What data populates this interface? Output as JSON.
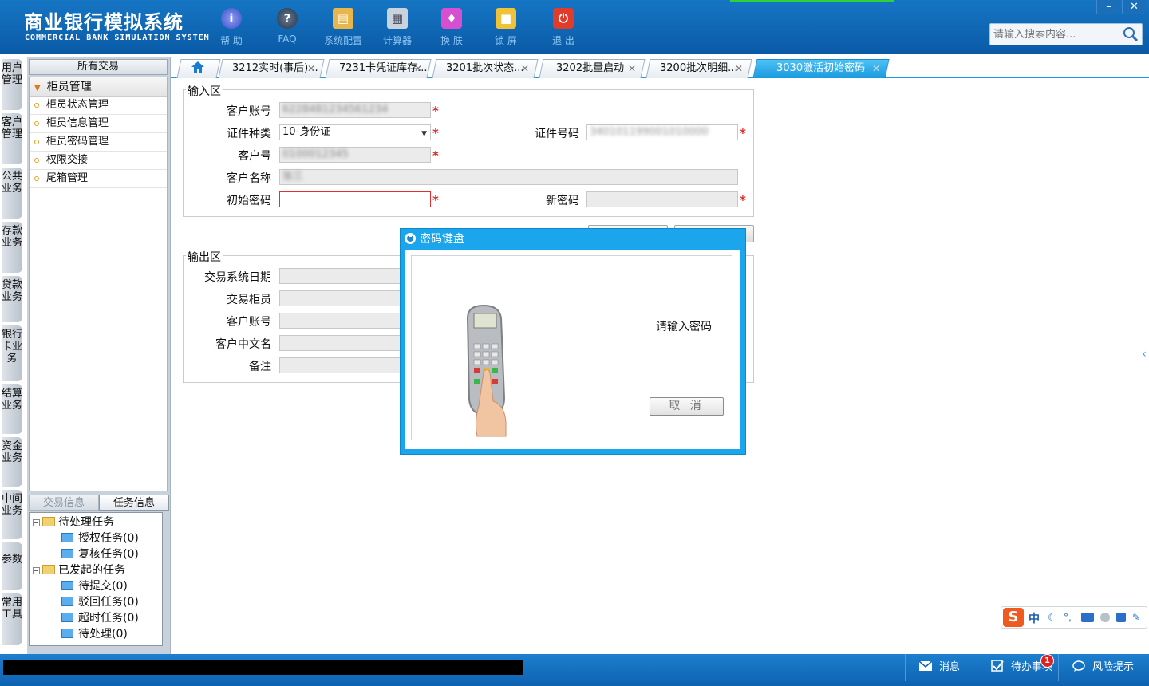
{
  "app": {
    "title_cn": "商业银行模拟系统",
    "title_en": "COMMERCIAL BANK SIMULATION SYSTEM"
  },
  "toolbar": {
    "help": "帮 助",
    "faq": "FAQ",
    "config": "系统配置",
    "calculator": "计算器",
    "skin": "换 肤",
    "lock": "锁 屏",
    "exit": "退 出"
  },
  "window": {
    "minimize": "–",
    "close": "✕"
  },
  "search": {
    "placeholder": "请输入搜索内容..."
  },
  "side_tabs": [
    "用户管理",
    "客户管理",
    "公共业务",
    "存款业务",
    "贷款业务",
    "银行卡业务",
    "结算业务",
    "资金业务",
    "中间业务",
    "参数",
    "常用工具"
  ],
  "left_panel": {
    "header": "所有交易",
    "group": "柜员管理",
    "items": [
      "柜员状态管理",
      "柜员信息管理",
      "柜员密码管理",
      "权限交接",
      "尾箱管理"
    ],
    "tabs": [
      "交易信息",
      "任务信息"
    ],
    "tree": {
      "pending": "待处理任务",
      "authorize": "授权任务(0)",
      "review": "复核任务(0)",
      "initiated": "已发起的任务",
      "to_submit": "待提交(0)",
      "rejected": "驳回任务(0)",
      "timeout": "超时任务(0)",
      "to_process": "待处理(0)"
    }
  },
  "tabs": [
    {
      "label": "3212实时(事后)..."
    },
    {
      "label": "7231卡凭证库存..."
    },
    {
      "label": "3201批次状态..."
    },
    {
      "label": "3202批量启动"
    },
    {
      "label": "3200批次明细..."
    },
    {
      "label": "3030激活初始密码"
    }
  ],
  "input_area": {
    "legend": "输入区",
    "account_label": "客户账号",
    "account_value": "6228481234561234",
    "id_type_label": "证件种类",
    "id_type_value": "10-身份证",
    "id_no_label": "证件号码",
    "id_no_value": "340101199001010000",
    "customer_no_label": "客户号",
    "customer_no_value": "0100012345",
    "customer_name_label": "客户名称",
    "customer_name_value": "张三",
    "init_pwd_label": "初始密码",
    "new_pwd_label": "新密码",
    "required": "*"
  },
  "output_area": {
    "legend": "输出区",
    "fields": [
      "交易系统日期",
      "交易柜员",
      "客户账号",
      "客户中文名",
      "备注"
    ]
  },
  "dialog": {
    "title": "密码键盘",
    "prompt": "请输入密码",
    "cancel": "取 消"
  },
  "status": {
    "messages": "消息",
    "todo": "待办事项",
    "todo_count": "1",
    "risk": "风险提示"
  },
  "ime": {
    "logo": "S",
    "mode": "中"
  }
}
